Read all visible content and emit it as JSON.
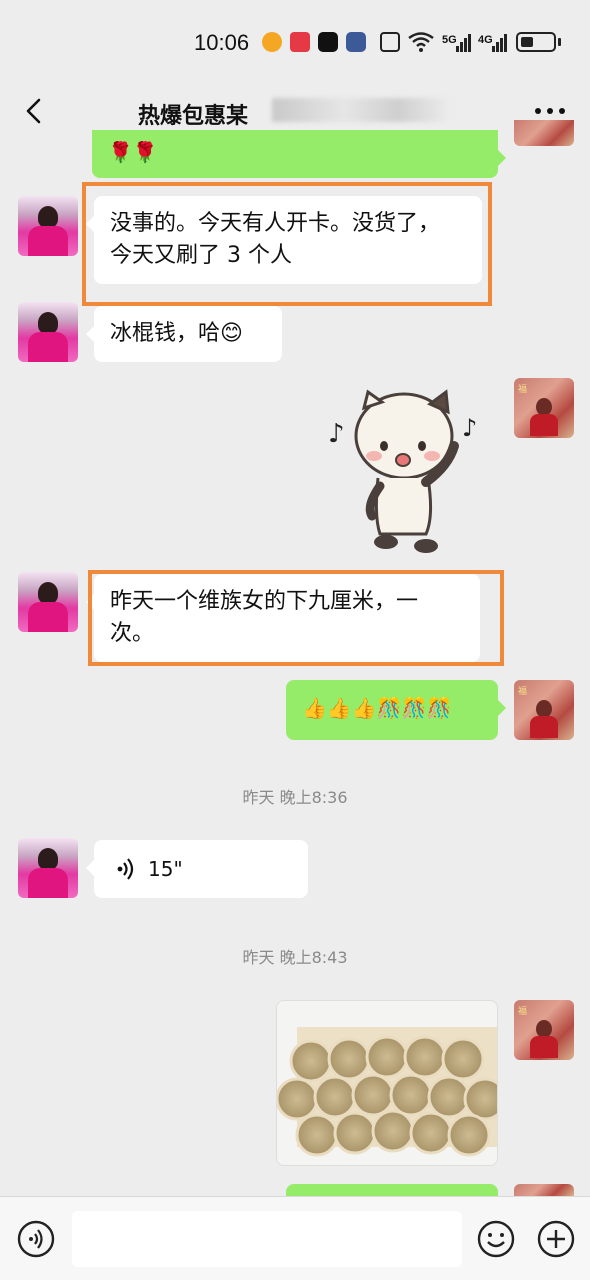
{
  "status_bar": {
    "time": "10:06",
    "signal_1": "5G",
    "signal_2": "4G"
  },
  "header": {
    "title": "热爆包惠某",
    "back_icon": "chevron-left-icon",
    "more_icon": "more-dots-icon"
  },
  "messages": [
    {
      "side": "out",
      "kind": "emoji",
      "text": "🌹🌹"
    },
    {
      "side": "in",
      "kind": "text",
      "text": "没事的。今天有人开卡。没货了，今天又刷了3个人",
      "line1": "没事的。今天有人开卡。没货了，",
      "line2": "今天又刷了 3 个人"
    },
    {
      "side": "in",
      "kind": "text",
      "text": "冰棍钱，哈😊"
    },
    {
      "side": "out",
      "kind": "sticker",
      "sticker": "dancing-panda-sticker"
    },
    {
      "side": "in",
      "kind": "text",
      "line1": "昨天一个维族女的下九厘米，一",
      "line2": "次。"
    },
    {
      "side": "out",
      "kind": "emoji",
      "text": "👍👍👍🎊🎊🎊"
    },
    {
      "kind": "time",
      "text": "昨天 晚上8:36"
    },
    {
      "side": "in",
      "kind": "voice",
      "duration": "15\""
    },
    {
      "kind": "time",
      "text": "昨天 晚上8:43"
    },
    {
      "side": "out",
      "kind": "image",
      "image": "moxa-sticks-photo"
    }
  ],
  "input_bar": {
    "voice_icon": "voice-input-icon",
    "emoji_icon": "emoji-icon",
    "plus_icon": "plus-icon"
  },
  "colors": {
    "background": "#ededed",
    "bubble_out": "#95ec69",
    "bubble_in": "#ffffff",
    "highlight": "#ef8a3c"
  }
}
